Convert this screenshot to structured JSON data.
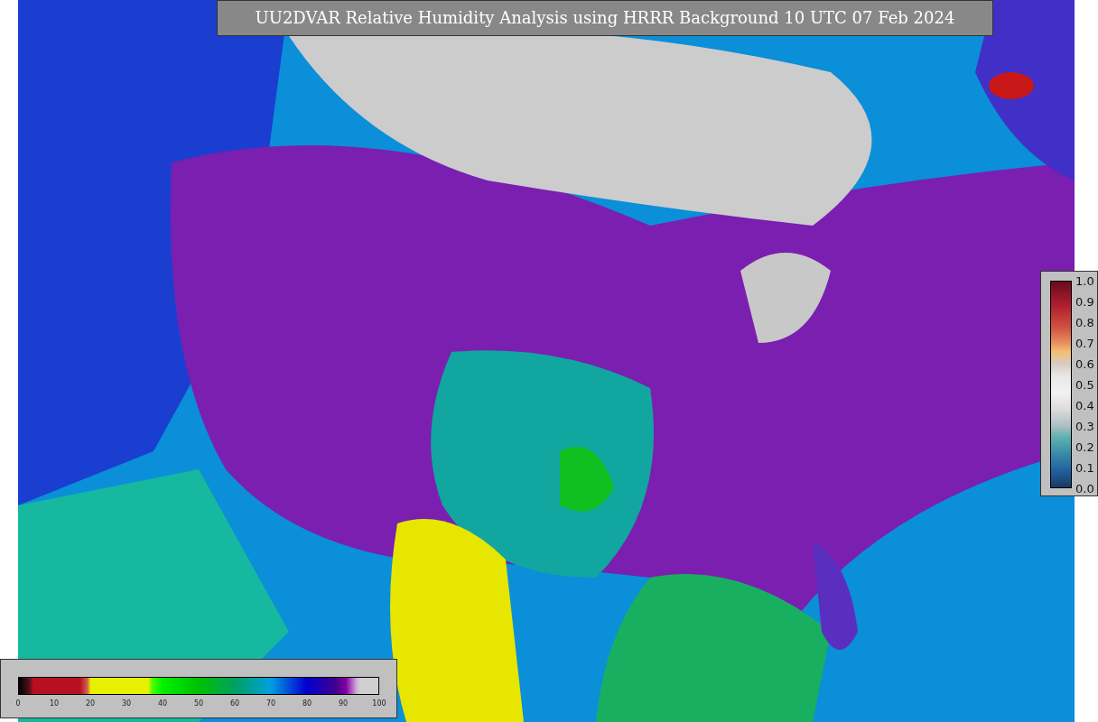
{
  "title": "UU2DVAR Relative Humidity Analysis using HRRR Background 10 UTC 07 Feb 2024",
  "humidity_colorbar": {
    "ticks": [
      "0",
      "10",
      "20",
      "30",
      "40",
      "50",
      "60",
      "70",
      "80",
      "90",
      "100"
    ]
  },
  "observation_colorbar": {
    "ticks": [
      "1.0",
      "0.9",
      "0.8",
      "0.7",
      "0.6",
      "0.5",
      "0.4",
      "0.3",
      "0.2",
      "0.1",
      "0.0"
    ]
  }
}
